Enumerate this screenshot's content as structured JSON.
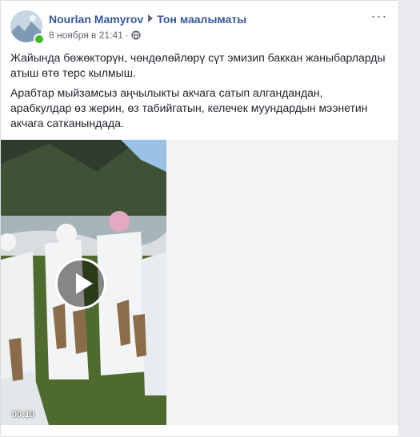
{
  "post": {
    "author": "Nourlan Mamyrov",
    "target": "Тон маалыматы",
    "timestamp": "8 ноября в 21:41",
    "separator": "·",
    "more_label": "···",
    "paragraphs": [
      "Жайында бөжөкторүн, чөндөлөйлөрү сүт эмизип баккан жаныбарларды атыш өтө терс кылмыш.",
      "Арабтар мыйзамсыз аңчылыкты акчага сатып алгандандан, арабкулдар өз жерин, өз табийгатын, келечек муундардын мээнетин акчага сатканындада."
    ]
  },
  "video": {
    "duration": "00:19"
  },
  "icons": {
    "avatar": "avatar",
    "online": "online-indicator",
    "arrow": "caret-right-icon",
    "privacy": "globe-icon",
    "play": "play-icon",
    "more": "more-options-icon"
  },
  "colors": {
    "link": "#385898",
    "text": "#1d2129",
    "meta": "#616770",
    "online": "#42b72a",
    "background": "#e9ebee"
  }
}
